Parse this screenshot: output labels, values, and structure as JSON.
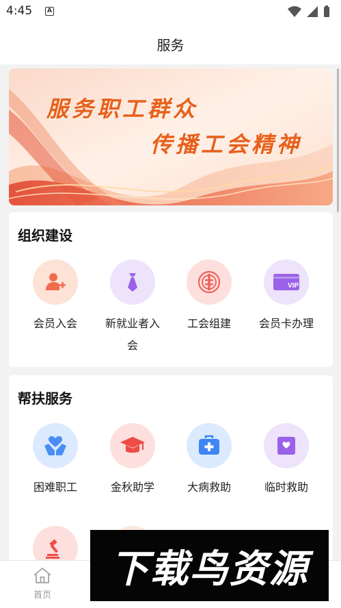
{
  "status_bar": {
    "time": "4:45",
    "notification_glyph": "A"
  },
  "app_bar": {
    "title": "服务"
  },
  "banner": {
    "line1": "服务职工群众",
    "line2": "传播工会精神"
  },
  "sections": [
    {
      "title": "组织建设",
      "items": [
        {
          "label": "会员入会",
          "icon": "person-add-icon",
          "bg": "#fde2d6",
          "color": "#f26b4f"
        },
        {
          "label": "新就业者入会",
          "icon": "necktie-icon",
          "bg": "#ede3fb",
          "color": "#9a62e8"
        },
        {
          "label": "工会组建",
          "icon": "union-emblem-icon",
          "bg": "#fde0dd",
          "color": "#f0605a"
        },
        {
          "label": "会员卡办理",
          "icon": "vip-card-icon",
          "bg": "#ede3fb",
          "color": "#9a62e8",
          "card_text": "VIP"
        }
      ]
    },
    {
      "title": "帮扶服务",
      "items": [
        {
          "label": "困难职工",
          "icon": "heart-hands-icon",
          "bg": "#dceaff",
          "color": "#4a8ef5"
        },
        {
          "label": "金秋助学",
          "icon": "graduation-cap-icon",
          "bg": "#fde0dd",
          "color": "#ef4b47"
        },
        {
          "label": "大病救助",
          "icon": "medical-kit-icon",
          "bg": "#dceaff",
          "color": "#3f86f3"
        },
        {
          "label": "临时救助",
          "icon": "heart-box-icon",
          "bg": "#ede3fb",
          "color": "#9a62e8"
        },
        {
          "label": "",
          "icon": "gavel-icon",
          "bg": "#fde0dd",
          "color": "#ef4b47"
        },
        {
          "label": "",
          "icon": "partial-icon",
          "bg": "#fde8dd",
          "color": "#f26b4f"
        }
      ]
    }
  ],
  "bottom_nav": {
    "home_label": "首页"
  },
  "watermark": {
    "text": "下载鸟资源"
  }
}
